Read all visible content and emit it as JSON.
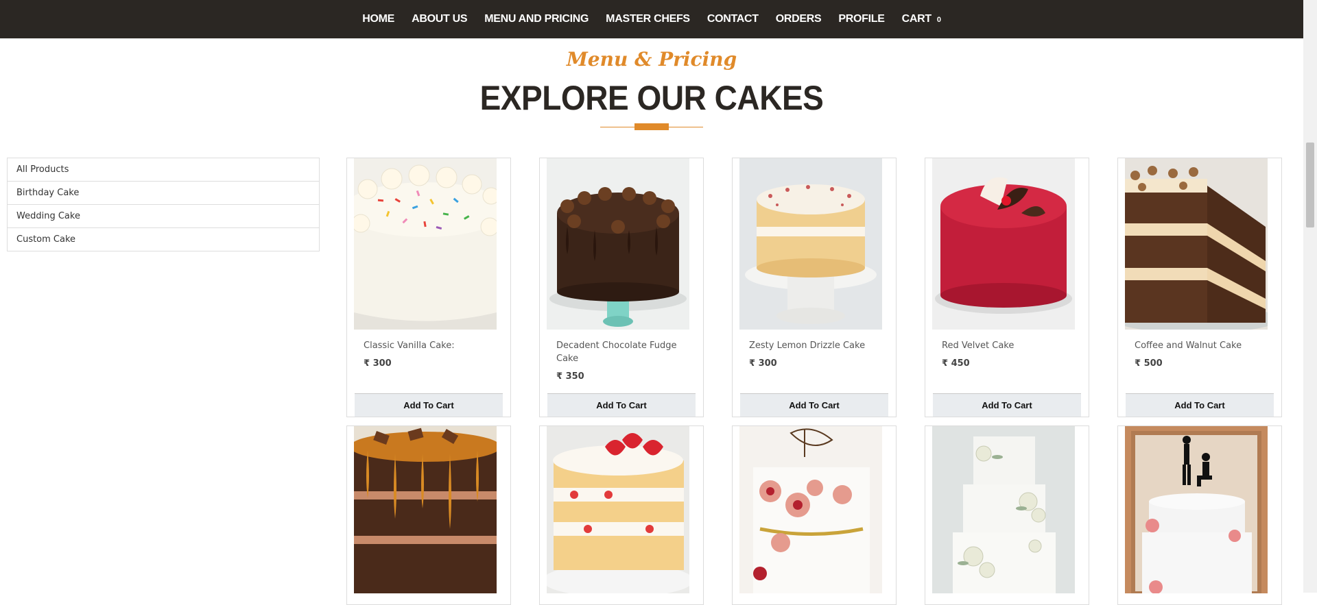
{
  "nav": {
    "items": [
      "HOME",
      "ABOUT US",
      "MENU AND PRICING",
      "MASTER CHEFS",
      "CONTACT",
      "ORDERS",
      "PROFILE",
      "CART"
    ],
    "cart_count": "0"
  },
  "section": {
    "subtitle": "Menu & Pricing",
    "title": "EXPLORE OUR CAKES"
  },
  "categories": [
    "All Products",
    "Birthday Cake",
    "Wedding Cake",
    "Custom Cake"
  ],
  "products": [
    {
      "name": "Classic Vanilla Cake:",
      "price": "₹ 300",
      "button": "Add To Cart"
    },
    {
      "name": "Decadent Chocolate Fudge Cake",
      "price": "₹ 350",
      "button": "Add To Cart"
    },
    {
      "name": "Zesty Lemon Drizzle Cake",
      "price": "₹ 300",
      "button": "Add To Cart"
    },
    {
      "name": "Red Velvet Cake",
      "price": "₹ 450",
      "button": "Add To Cart"
    },
    {
      "name": "Coffee and Walnut Cake",
      "price": "₹ 500",
      "button": "Add To Cart"
    }
  ],
  "colors": {
    "nav_bg": "#2b2723",
    "accent": "#e08a2a"
  }
}
